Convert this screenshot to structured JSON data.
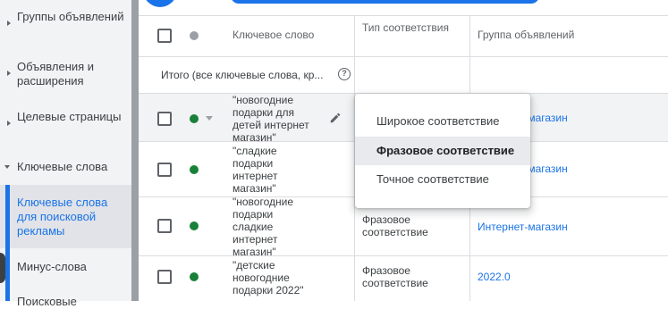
{
  "sidebar": {
    "items": [
      {
        "label": "Группы объявлений",
        "expand": "collapsed"
      },
      {
        "label": "Объявления и расширения",
        "expand": "collapsed"
      },
      {
        "label": "Целевые страницы",
        "expand": "collapsed"
      },
      {
        "label": "Ключевые слова",
        "expand": "expanded"
      },
      {
        "label": "Ключевые слова для поисковой рекламы",
        "active": true
      },
      {
        "label": "Минус-слова"
      },
      {
        "label": "Поисковые"
      }
    ]
  },
  "table": {
    "headers": {
      "keyword": "Ключевое слово",
      "match_type": "Тип соответствия",
      "ad_group": "Группа объявлений"
    },
    "total_label": "Итого (все ключевые слова, кр...",
    "help_icon": "?",
    "rows": [
      {
        "keyword": "\"новогодние подарки для детей интернет магазин\"",
        "match_type": "",
        "ad_group": "Интернет-магазин",
        "status": "enabled"
      },
      {
        "keyword": "\"сладкие подарки интернет магазин\"",
        "match_type": "",
        "ad_group": "Интернет-магазин",
        "status": "enabled"
      },
      {
        "keyword": "\"новогодние подарки сладкие интернет магазин\"",
        "match_type": "Фразовое соответствие",
        "ad_group": "Интернет-магазин",
        "status": "enabled"
      },
      {
        "keyword": "\"детские новогодние подарки 2022\"",
        "match_type": "Фразовое соответствие",
        "ad_group": "2022.0",
        "status": "enabled"
      }
    ]
  },
  "dropdown": {
    "options": [
      "Широкое соответствие",
      "Фразовое соответствие",
      "Точное соответствие"
    ],
    "selected": "Фразовое соответствие"
  },
  "colors": {
    "accent": "#1a73e8",
    "status_enabled": "#188038",
    "sidebar_bg": "#f1f3f4"
  },
  "icons": {
    "edit": "pencil-icon",
    "help": "help-circle-icon",
    "status": "status-dot-icon"
  }
}
